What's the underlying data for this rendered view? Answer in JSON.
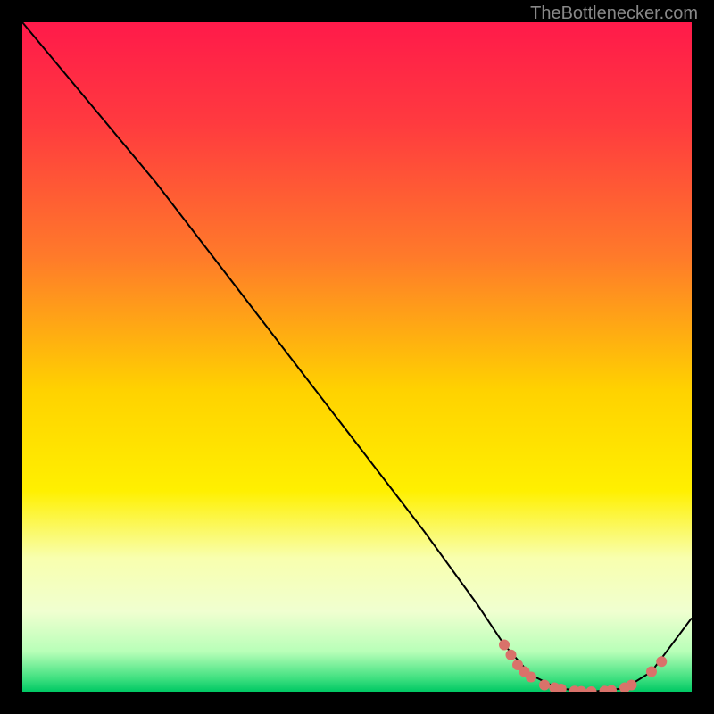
{
  "watermark": "TheBottlenecker.com",
  "chart_data": {
    "type": "line",
    "title": "",
    "xlabel": "",
    "ylabel": "",
    "xlim": [
      0,
      100
    ],
    "ylim": [
      0,
      100
    ],
    "gradient_stops": [
      {
        "offset": 0,
        "color": "#ff1a4a"
      },
      {
        "offset": 15,
        "color": "#ff3a3f"
      },
      {
        "offset": 35,
        "color": "#ff7a2a"
      },
      {
        "offset": 55,
        "color": "#ffd200"
      },
      {
        "offset": 70,
        "color": "#fff000"
      },
      {
        "offset": 80,
        "color": "#f8ffae"
      },
      {
        "offset": 88,
        "color": "#f0ffd0"
      },
      {
        "offset": 94,
        "color": "#b8ffb8"
      },
      {
        "offset": 98,
        "color": "#40e080"
      },
      {
        "offset": 100,
        "color": "#00c864"
      }
    ],
    "series": [
      {
        "name": "bottleneck-curve",
        "color": "#000000",
        "points": [
          {
            "x": 0,
            "y": 100
          },
          {
            "x": 5,
            "y": 94
          },
          {
            "x": 10,
            "y": 88
          },
          {
            "x": 20,
            "y": 76
          },
          {
            "x": 30,
            "y": 63
          },
          {
            "x": 40,
            "y": 50
          },
          {
            "x": 50,
            "y": 37
          },
          {
            "x": 60,
            "y": 24
          },
          {
            "x": 68,
            "y": 13
          },
          {
            "x": 72,
            "y": 7
          },
          {
            "x": 76,
            "y": 2.5
          },
          {
            "x": 80,
            "y": 0.5
          },
          {
            "x": 85,
            "y": 0
          },
          {
            "x": 90,
            "y": 0.5
          },
          {
            "x": 94,
            "y": 3
          },
          {
            "x": 100,
            "y": 11
          }
        ]
      }
    ],
    "markers": [
      {
        "x": 72,
        "y": 7.0
      },
      {
        "x": 73,
        "y": 5.5
      },
      {
        "x": 74,
        "y": 4.0
      },
      {
        "x": 75,
        "y": 3.0
      },
      {
        "x": 76,
        "y": 2.2
      },
      {
        "x": 78,
        "y": 1.0
      },
      {
        "x": 79.5,
        "y": 0.6
      },
      {
        "x": 80.5,
        "y": 0.4
      },
      {
        "x": 82.5,
        "y": 0.1
      },
      {
        "x": 83.5,
        "y": 0.05
      },
      {
        "x": 85,
        "y": 0
      },
      {
        "x": 87,
        "y": 0.1
      },
      {
        "x": 88,
        "y": 0.2
      },
      {
        "x": 90,
        "y": 0.6
      },
      {
        "x": 91,
        "y": 1.0
      },
      {
        "x": 94,
        "y": 3.0
      },
      {
        "x": 95.5,
        "y": 4.5
      }
    ],
    "marker_color": "#d9726a",
    "marker_radius": 6
  }
}
